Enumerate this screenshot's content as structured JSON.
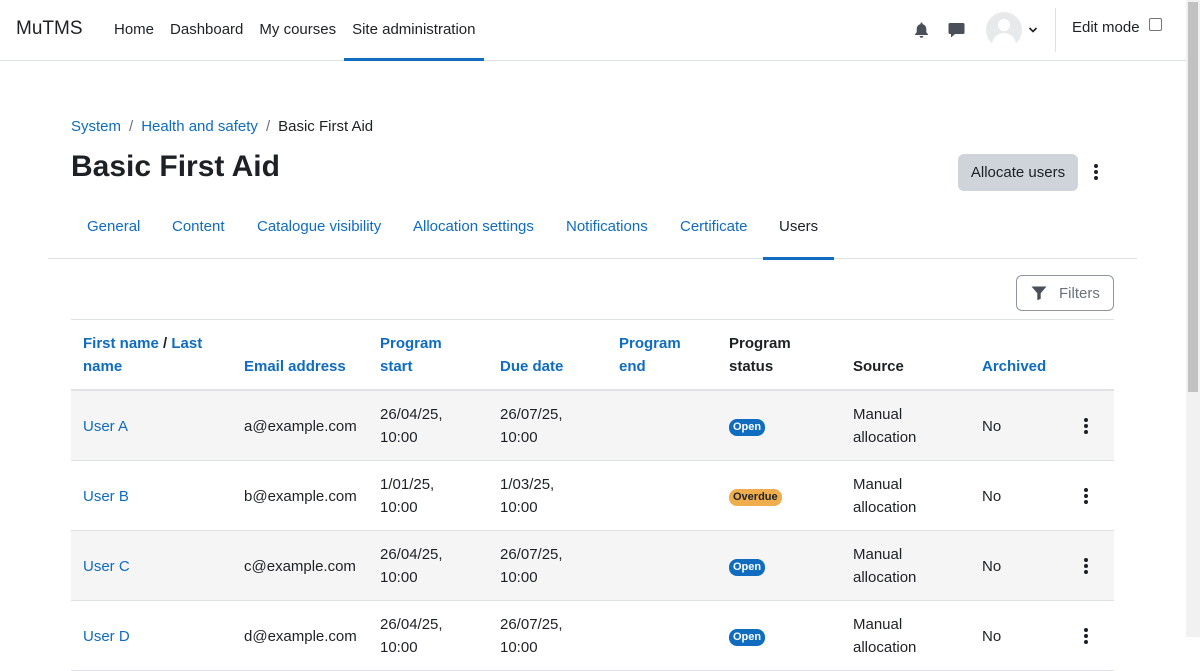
{
  "app": {
    "brand": "MuTMS"
  },
  "nav": {
    "items": [
      "Home",
      "Dashboard",
      "My courses",
      "Site administration"
    ],
    "active": "Site administration"
  },
  "icons": {
    "notifications": "bell-icon",
    "messages": "message-icon",
    "user": "avatar",
    "menu": "kebab-icon",
    "filter": "filter-icon"
  },
  "edit_mode": {
    "label": "Edit mode",
    "checked": false
  },
  "breadcrumb": {
    "items": [
      "System",
      "Health and safety"
    ],
    "current": "Basic First Aid"
  },
  "page": {
    "title": "Basic First Aid",
    "allocate_label": "Allocate users"
  },
  "tabs": [
    "General",
    "Content",
    "Catalogue visibility",
    "Allocation settings",
    "Notifications",
    "Certificate",
    "Users"
  ],
  "active_tab": "Users",
  "filters_label": "Filters",
  "table": {
    "headers": {
      "first_name": "First name",
      "sep": "/",
      "last_name_1": "Last",
      "last_name_2": "name",
      "email": "Email address",
      "start_1": "Program",
      "start_2": "start",
      "due": "Due date",
      "end_1": "Program",
      "end_2": "end",
      "status_1": "Program",
      "status_2": "status",
      "source": "Source",
      "archived": "Archived"
    },
    "rows": [
      {
        "name": "User A",
        "email": "a@example.com",
        "start_date": "26/04/25,",
        "start_time": "10:00",
        "due_date": "26/07/25,",
        "due_time": "10:00",
        "end": "",
        "status": "Open",
        "source_1": "Manual",
        "source_2": "allocation",
        "archived": "No"
      },
      {
        "name": "User B",
        "email": "b@example.com",
        "start_date": "1/01/25,",
        "start_time": "10:00",
        "due_date": "1/03/25,",
        "due_time": "10:00",
        "end": "",
        "status": "Overdue",
        "source_1": "Manual",
        "source_2": "allocation",
        "archived": "No"
      },
      {
        "name": "User C",
        "email": "c@example.com",
        "start_date": "26/04/25,",
        "start_time": "10:00",
        "due_date": "26/07/25,",
        "due_time": "10:00",
        "end": "",
        "status": "Open",
        "source_1": "Manual",
        "source_2": "allocation",
        "archived": "No"
      },
      {
        "name": "User D",
        "email": "d@example.com",
        "start_date": "26/04/25,",
        "start_time": "10:00",
        "due_date": "26/07/25,",
        "due_time": "10:00",
        "end": "",
        "status": "Open",
        "source_1": "Manual",
        "source_2": "allocation",
        "archived": "No"
      }
    ]
  },
  "colors": {
    "link": "#0f6cbf",
    "open_badge": "#0f6cbf",
    "overdue_badge": "#f0ad4e"
  }
}
